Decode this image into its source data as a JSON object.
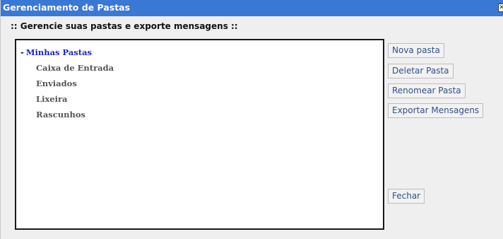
{
  "dialog": {
    "title": "Gerenciamento de Pastas",
    "close_glyph": "✕",
    "subtitle": ":: Gerencie suas pastas e exporte mensagens ::"
  },
  "tree": {
    "toggle": "-",
    "root_label": "Minhas Pastas",
    "folders": [
      "Caixa de Entrada",
      "Enviados",
      "Lixeira",
      "Rascunhos"
    ]
  },
  "buttons": {
    "new_folder": "Nova pasta",
    "delete_folder": "Deletar Pasta",
    "rename_folder": "Renomear Pasta",
    "export_messages": "Exportar Mensagens",
    "close": "Fechar"
  },
  "colors": {
    "titlebar": "#3a78d6",
    "root_link": "#1c1cd6",
    "folder_text": "#555555",
    "button_text": "#30508a"
  }
}
